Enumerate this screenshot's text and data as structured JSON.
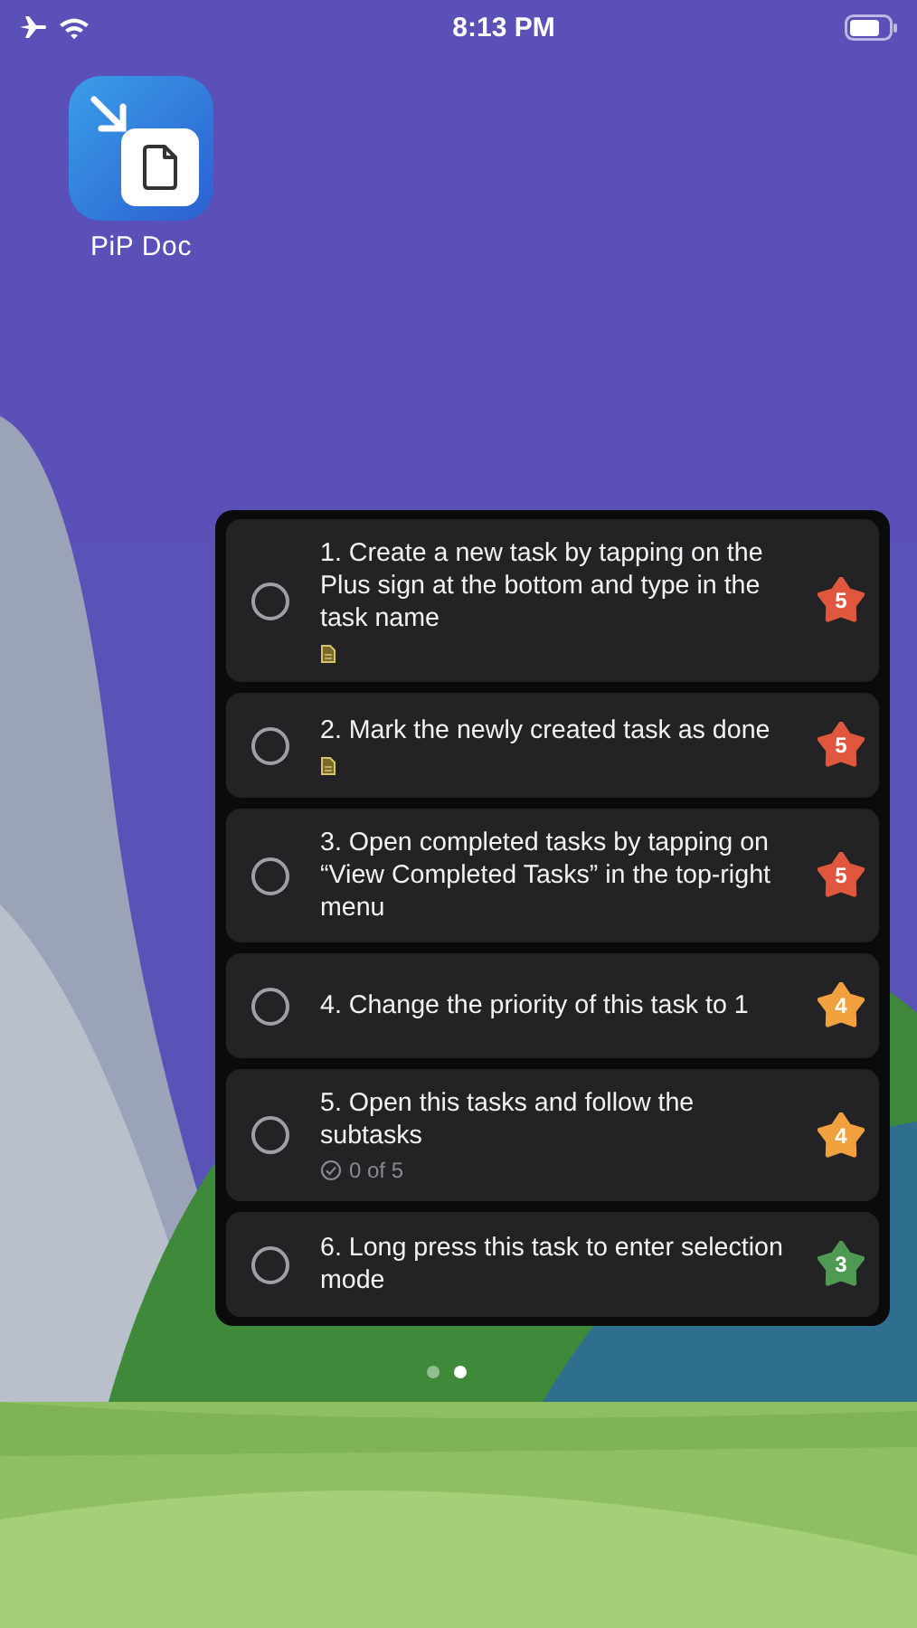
{
  "status_bar": {
    "airplane_mode": true,
    "time": "8:13 PM"
  },
  "home_app": {
    "label": "PiP Doc"
  },
  "tasks": [
    {
      "title": "1. Create a new task by tapping on the Plus sign at the bottom and type in the task name",
      "checked": false,
      "has_note": true,
      "priority": "5",
      "color": "#e0573f"
    },
    {
      "title": "2. Mark the newly created task as done",
      "checked": false,
      "has_note": true,
      "priority": "5",
      "color": "#e0573f"
    },
    {
      "title": "3. Open completed tasks by tapping on “View Completed Tasks” in the top-right menu",
      "checked": false,
      "has_note": false,
      "priority": "5",
      "color": "#e0573f"
    },
    {
      "title": "4. Change the priority of this task to 1",
      "checked": false,
      "has_note": false,
      "priority": "4",
      "color": "#f0a03c"
    },
    {
      "title": "5. Open this tasks and follow the subtasks",
      "checked": false,
      "has_note": false,
      "subtasks": "0 of 5",
      "priority": "4",
      "color": "#f0a03c"
    },
    {
      "title": "6. Long press this task to enter selection mode",
      "checked": false,
      "has_note": false,
      "priority": "3",
      "color": "#4e9a52"
    }
  ],
  "page_dots": [
    {
      "selected": false
    },
    {
      "selected": true
    }
  ]
}
